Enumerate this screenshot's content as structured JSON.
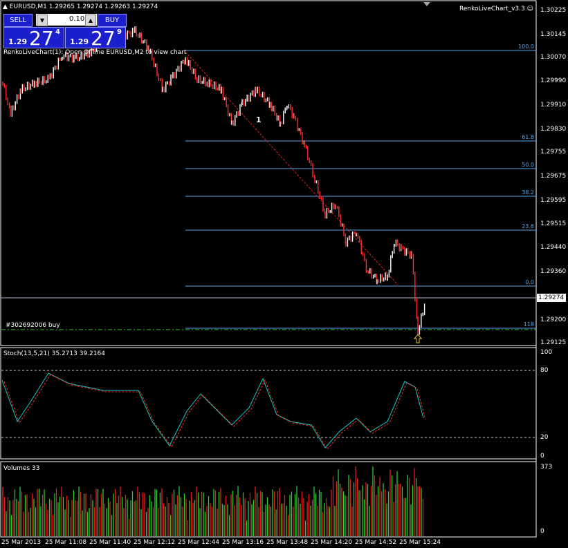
{
  "header": {
    "symbol_line": "EURUSD,M1  1.29265 1.29274 1.29263 1.29274",
    "expert_name": "RenkoLiveChart_v3.3",
    "smiley_icon": "smiley-icon",
    "info_text": "RenkoLiveChart(1): Open Offline EURUSD,M2 to view chart"
  },
  "trade_panel": {
    "sell_label": "SELL",
    "buy_label": "BUY",
    "lot_value": "0.10",
    "sell_small": "1.29",
    "sell_big": "27",
    "sell_sup": "4",
    "buy_small": "1.29",
    "buy_big": "27",
    "buy_sup": "9"
  },
  "price_axis": [
    "1.30225",
    "1.30145",
    "1.30070",
    "1.29990",
    "1.29910",
    "1.29830",
    "1.29755",
    "1.29675",
    "1.29595",
    "1.29515",
    "1.29440",
    "1.29360",
    "1.29200",
    "1.29125"
  ],
  "current_price": "1.29274",
  "fib_levels": [
    "100.0",
    "61.8",
    "50.0",
    "38.2",
    "23.6",
    "0.0",
    "118"
  ],
  "wave_label": "1",
  "order_label": "#302692006 buy",
  "stoch": {
    "title": "Stoch(13,5,21) 35.2713 39.2164",
    "axis": [
      "100",
      "80",
      "20",
      "0"
    ]
  },
  "volumes": {
    "title": "Volumes 33",
    "axis": [
      "373",
      "0"
    ]
  },
  "time_axis": [
    "25 Mar 2013",
    "25 Mar 11:08",
    "25 Mar 11:40",
    "25 Mar 12:12",
    "25 Mar 12:44",
    "25 Mar 13:16",
    "25 Mar 13:48",
    "25 Mar 14:20",
    "25 Mar 14:52",
    "25 Mar 15:24"
  ],
  "colors": {
    "up": "#ffffff",
    "down": "#ff2a2a",
    "grid": "#59a6e6",
    "main": "#19c8c8",
    "signal": "#ff2a2a",
    "vol_up": "#2ecc2e",
    "vol_down": "#e01e1e"
  }
}
